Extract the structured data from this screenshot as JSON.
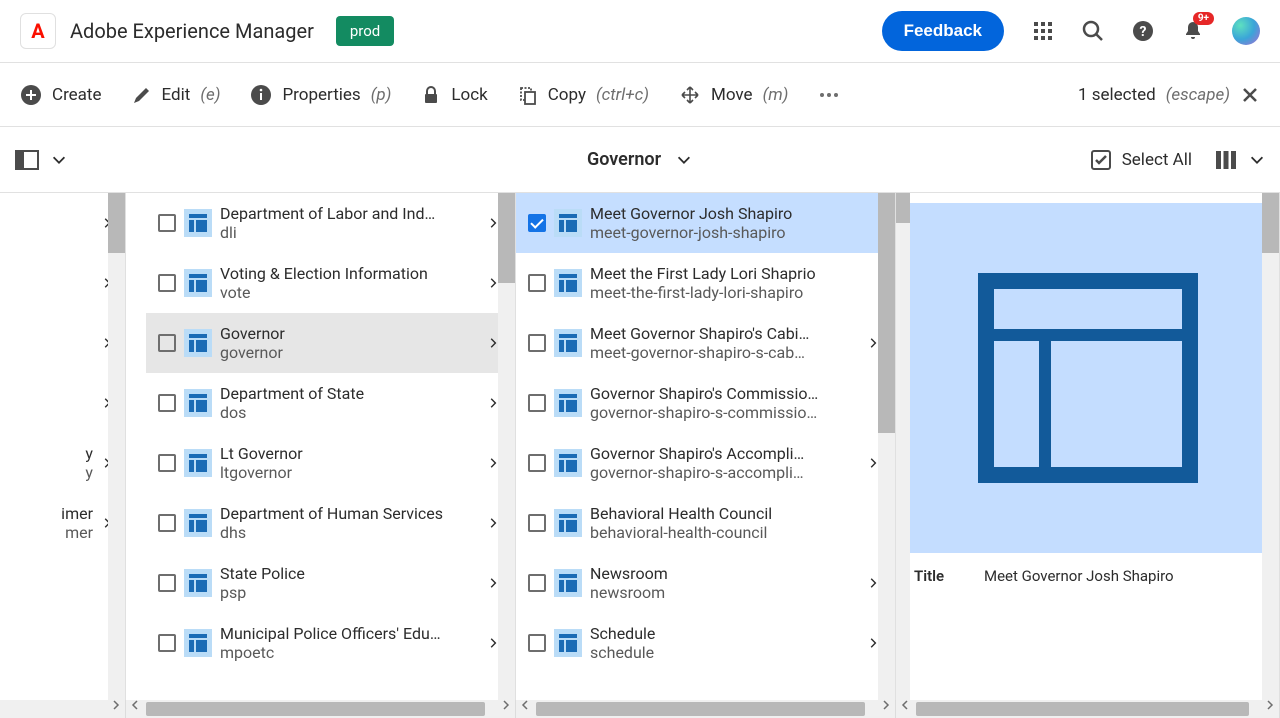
{
  "header": {
    "brand": "Adobe Experience Manager",
    "env": "prod",
    "feedback": "Feedback",
    "notif_badge": "9+"
  },
  "toolbar": {
    "create": "Create",
    "edit": "Edit",
    "edit_sc": "(e)",
    "properties": "Properties",
    "properties_sc": "(p)",
    "lock": "Lock",
    "copy": "Copy",
    "copy_sc": "(ctrl+c)",
    "move": "Move",
    "move_sc": "(m)",
    "selected": "1 selected",
    "escape": "(escape)"
  },
  "subheader": {
    "title": "Governor",
    "select_all": "Select All"
  },
  "col0": [
    {
      "title": "",
      "name": "",
      "active": false
    },
    {
      "title": "",
      "name": "",
      "active": false,
      "hidden": true,
      "spacer": false
    },
    {
      "title": "",
      "name": "",
      "active": false
    },
    {
      "title": "",
      "name": "",
      "active": false
    },
    {
      "title": "y",
      "name": "y",
      "active": false
    },
    {
      "title": "imer",
      "name": "mer",
      "active": false
    }
  ],
  "col1": [
    {
      "title": "Department of Labor and Ind…",
      "name": "dli",
      "arrow": true,
      "active": false
    },
    {
      "title": "Voting & Election Information",
      "name": "vote",
      "arrow": true,
      "active": false
    },
    {
      "title": "Governor",
      "name": "governor",
      "arrow": true,
      "active": true
    },
    {
      "title": "Department of State",
      "name": "dos",
      "arrow": true,
      "active": false
    },
    {
      "title": "Lt Governor",
      "name": "ltgovernor",
      "arrow": true,
      "active": false
    },
    {
      "title": "Department of Human Services",
      "name": "dhs",
      "arrow": true,
      "active": false
    },
    {
      "title": "State Police",
      "name": "psp",
      "arrow": true,
      "active": false
    },
    {
      "title": "Municipal Police Officers' Edu…",
      "name": "mpoetc",
      "arrow": true,
      "active": false
    }
  ],
  "col2": [
    {
      "title": "Meet Governor Josh Shapiro",
      "name": "meet-governor-josh-shapiro",
      "arrow": false,
      "selected": true
    },
    {
      "title": "Meet the First Lady Lori Shaprio",
      "name": "meet-the-first-lady-lori-shapiro",
      "arrow": false
    },
    {
      "title": "Meet Governor Shapiro's Cabi…",
      "name": "meet-governor-shapiro-s-cab…",
      "arrow": true
    },
    {
      "title": "Governor Shapiro's Commissio…",
      "name": "governor-shapiro-s-commissio…",
      "arrow": false
    },
    {
      "title": "Governor Shapiro's Accompli…",
      "name": "governor-shapiro-s-accompli…",
      "arrow": true
    },
    {
      "title": "Behavioral Health Council",
      "name": "behavioral-health-council",
      "arrow": false
    },
    {
      "title": "Newsroom",
      "name": "newsroom",
      "arrow": true
    },
    {
      "title": "Schedule",
      "name": "schedule",
      "arrow": true
    }
  ],
  "detail": {
    "title_label": "Title",
    "title_value": "Meet Governor Josh Shapiro"
  }
}
